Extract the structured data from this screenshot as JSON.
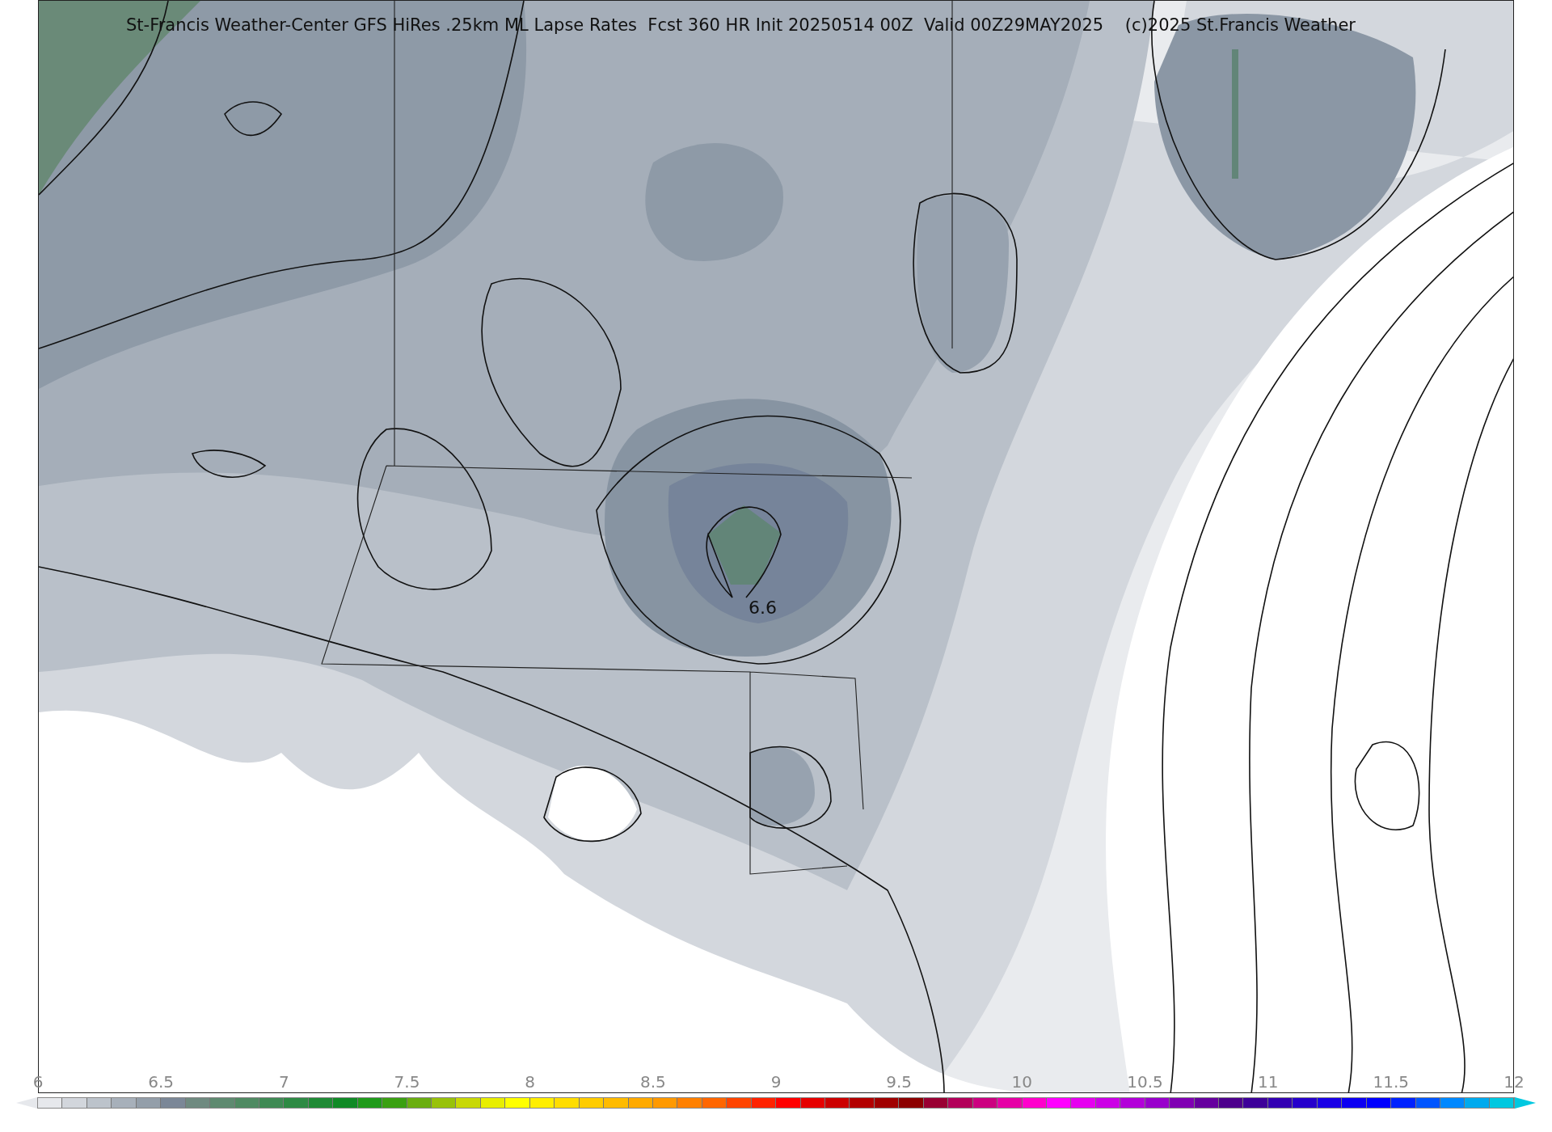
{
  "title": "St-Francis Weather-Center GFS HiRes .25km ML Lapse Rates  Fcst 360 HR Init 20250514 00Z  Valid 00Z29MAY2025    (c)2025 St.Francis Weather",
  "map": {
    "contour_label": "6.6"
  },
  "colorbar": {
    "ticks": [
      "6",
      "6.5",
      "7",
      "7.5",
      "8",
      "8.5",
      "9",
      "9.5",
      "10",
      "10.5",
      "11",
      "11.5",
      "12"
    ],
    "bins": [
      {
        "color": "#e6e8ec"
      },
      {
        "color": "#d2d6dc"
      },
      {
        "color": "#bcc3cb"
      },
      {
        "color": "#a7b0ba"
      },
      {
        "color": "#939ea9"
      },
      {
        "color": "#7b8797"
      },
      {
        "color": "#6f8a80"
      },
      {
        "color": "#5e8a70"
      },
      {
        "color": "#4f8a62"
      },
      {
        "color": "#3f8a54"
      },
      {
        "color": "#2e8a44"
      },
      {
        "color": "#1f8a35"
      },
      {
        "color": "#108a26"
      },
      {
        "color": "#1f9a1a"
      },
      {
        "color": "#3aa012"
      },
      {
        "color": "#6aae10"
      },
      {
        "color": "#98c20a"
      },
      {
        "color": "#c8d806"
      },
      {
        "color": "#e8ee00"
      },
      {
        "color": "#ffff00"
      },
      {
        "color": "#ffee00"
      },
      {
        "color": "#ffdd00"
      },
      {
        "color": "#ffcc00"
      },
      {
        "color": "#ffbb00"
      },
      {
        "color": "#ffaa00"
      },
      {
        "color": "#ff9900"
      },
      {
        "color": "#ff8000"
      },
      {
        "color": "#ff6600"
      },
      {
        "color": "#ff4400"
      },
      {
        "color": "#ff2200"
      },
      {
        "color": "#ff0000"
      },
      {
        "color": "#e60000"
      },
      {
        "color": "#cc0000"
      },
      {
        "color": "#b30000"
      },
      {
        "color": "#a00000"
      },
      {
        "color": "#8c0000"
      },
      {
        "color": "#990033"
      },
      {
        "color": "#b3005a"
      },
      {
        "color": "#cc0080"
      },
      {
        "color": "#e600a6"
      },
      {
        "color": "#ff00cc"
      },
      {
        "color": "#ff00ff"
      },
      {
        "color": "#e600f0"
      },
      {
        "color": "#cc00e6"
      },
      {
        "color": "#b300d9"
      },
      {
        "color": "#9900cc"
      },
      {
        "color": "#8000b3"
      },
      {
        "color": "#66009e"
      },
      {
        "color": "#4d008c"
      },
      {
        "color": "#3d0099"
      },
      {
        "color": "#3300b3"
      },
      {
        "color": "#2600cc"
      },
      {
        "color": "#1a00e6"
      },
      {
        "color": "#0d00f2"
      },
      {
        "color": "#0000ff"
      },
      {
        "color": "#0022ff"
      },
      {
        "color": "#0055ff"
      },
      {
        "color": "#0088ff"
      },
      {
        "color": "#00aaee"
      },
      {
        "color": "#00c8e0"
      }
    ]
  }
}
